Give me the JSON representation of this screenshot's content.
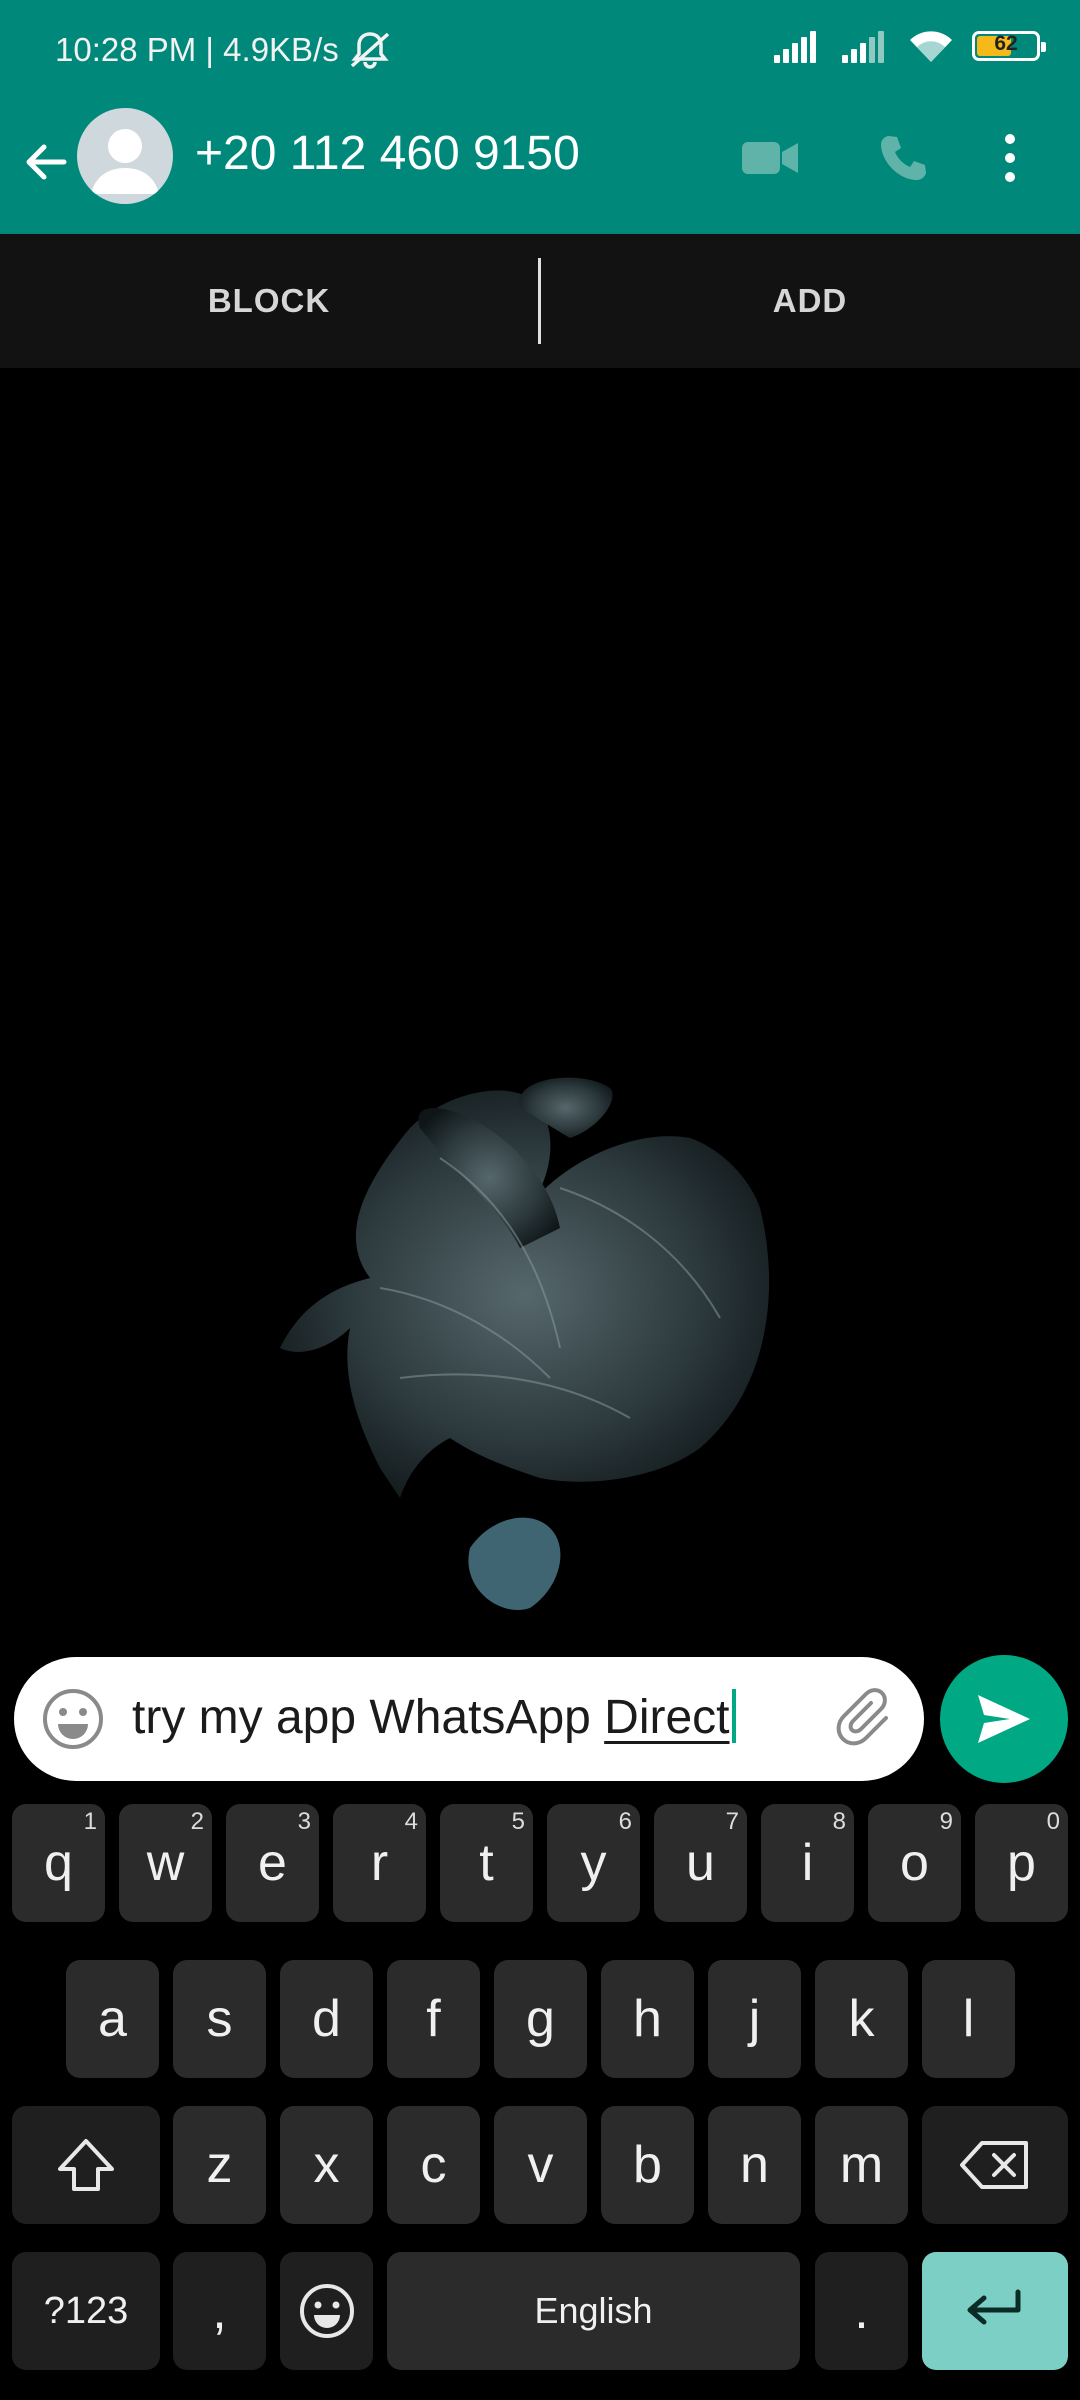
{
  "status_bar": {
    "time": "10:28 PM",
    "network_speed": "4.9KB/s",
    "battery_level": "62",
    "battery_percent": 62,
    "icons": [
      "mute-icon",
      "signal-icon",
      "signal-icon-2",
      "wifi-icon",
      "battery-icon"
    ]
  },
  "header": {
    "contact_name": "+20 112 460 9150",
    "icons": [
      "back-arrow-icon",
      "avatar-icon",
      "video-call-icon",
      "voice-call-icon",
      "more-options-icon"
    ]
  },
  "action_bar": {
    "block_label": "BLOCK",
    "add_label": "ADD"
  },
  "compose": {
    "text_plain": "try my app WhatsApp ",
    "text_composing": "Direct",
    "icons": [
      "emoji-icon",
      "attach-icon",
      "send-icon"
    ]
  },
  "keyboard": {
    "row1": [
      {
        "label": "q",
        "hint": "1"
      },
      {
        "label": "w",
        "hint": "2"
      },
      {
        "label": "e",
        "hint": "3"
      },
      {
        "label": "r",
        "hint": "4"
      },
      {
        "label": "t",
        "hint": "5"
      },
      {
        "label": "y",
        "hint": "6"
      },
      {
        "label": "u",
        "hint": "7"
      },
      {
        "label": "i",
        "hint": "8"
      },
      {
        "label": "o",
        "hint": "9"
      },
      {
        "label": "p",
        "hint": "0"
      }
    ],
    "row2": [
      "a",
      "s",
      "d",
      "f",
      "g",
      "h",
      "j",
      "k",
      "l"
    ],
    "row3": [
      "z",
      "x",
      "c",
      "v",
      "b",
      "n",
      "m"
    ],
    "symbols_label": "?123",
    "comma_label": ",",
    "space_label": "English",
    "period_label": ".",
    "icons": [
      "shift-icon",
      "backspace-icon",
      "emoji-key-icon",
      "enter-icon"
    ]
  },
  "colors": {
    "accent": "#00897b",
    "send": "#00a884",
    "enter_key": "#7ccfc4"
  }
}
